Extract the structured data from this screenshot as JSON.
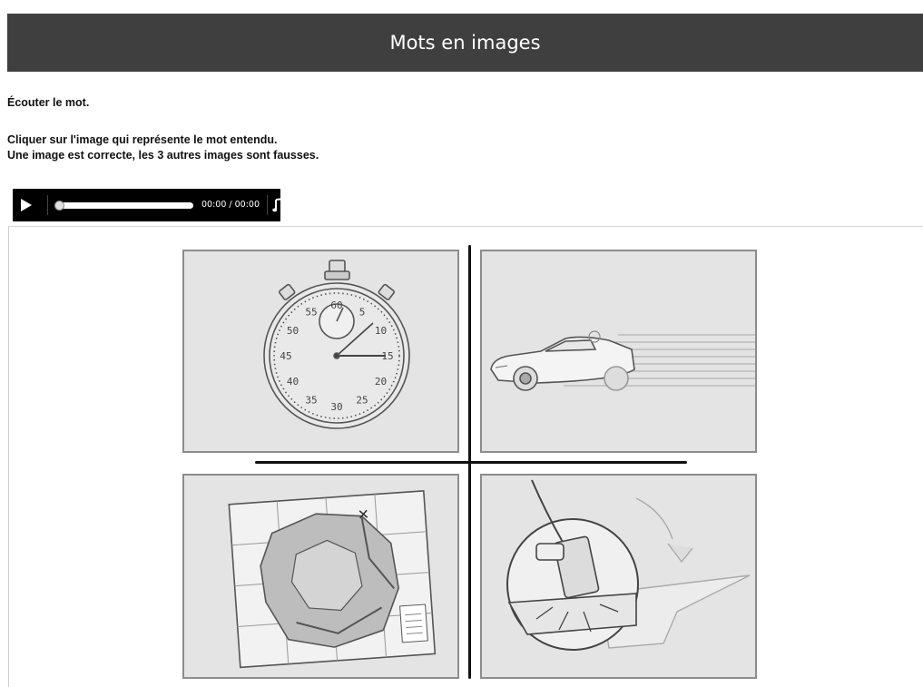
{
  "header": {
    "title": "Mots en images"
  },
  "instructions": {
    "line1": "Écouter le mot.",
    "line2": "Cliquer sur l'image qui représente le mot entendu.",
    "line3": "Une image est correcte, les 3 autres images sont fausses."
  },
  "audio": {
    "time": "00:00 / 00:00",
    "progress": 0,
    "icons": {
      "play": "play-icon",
      "audio": "music-note-icon"
    }
  },
  "stopwatch_labels": [
    "60",
    "5",
    "10",
    "15",
    "20",
    "25",
    "30",
    "35",
    "40",
    "45",
    "50",
    "55"
  ],
  "options": [
    {
      "id": "stopwatch",
      "depicts": "stopwatch"
    },
    {
      "id": "car",
      "depicts": "speeding car"
    },
    {
      "id": "map",
      "depicts": "city map"
    },
    {
      "id": "forge",
      "depicts": "hammer striking anvil"
    }
  ],
  "colors": {
    "header_bg": "#3f3f3f",
    "tile_bg": "#e4e4e4",
    "tile_border": "#8c8c8c",
    "player_bg": "#000000"
  }
}
